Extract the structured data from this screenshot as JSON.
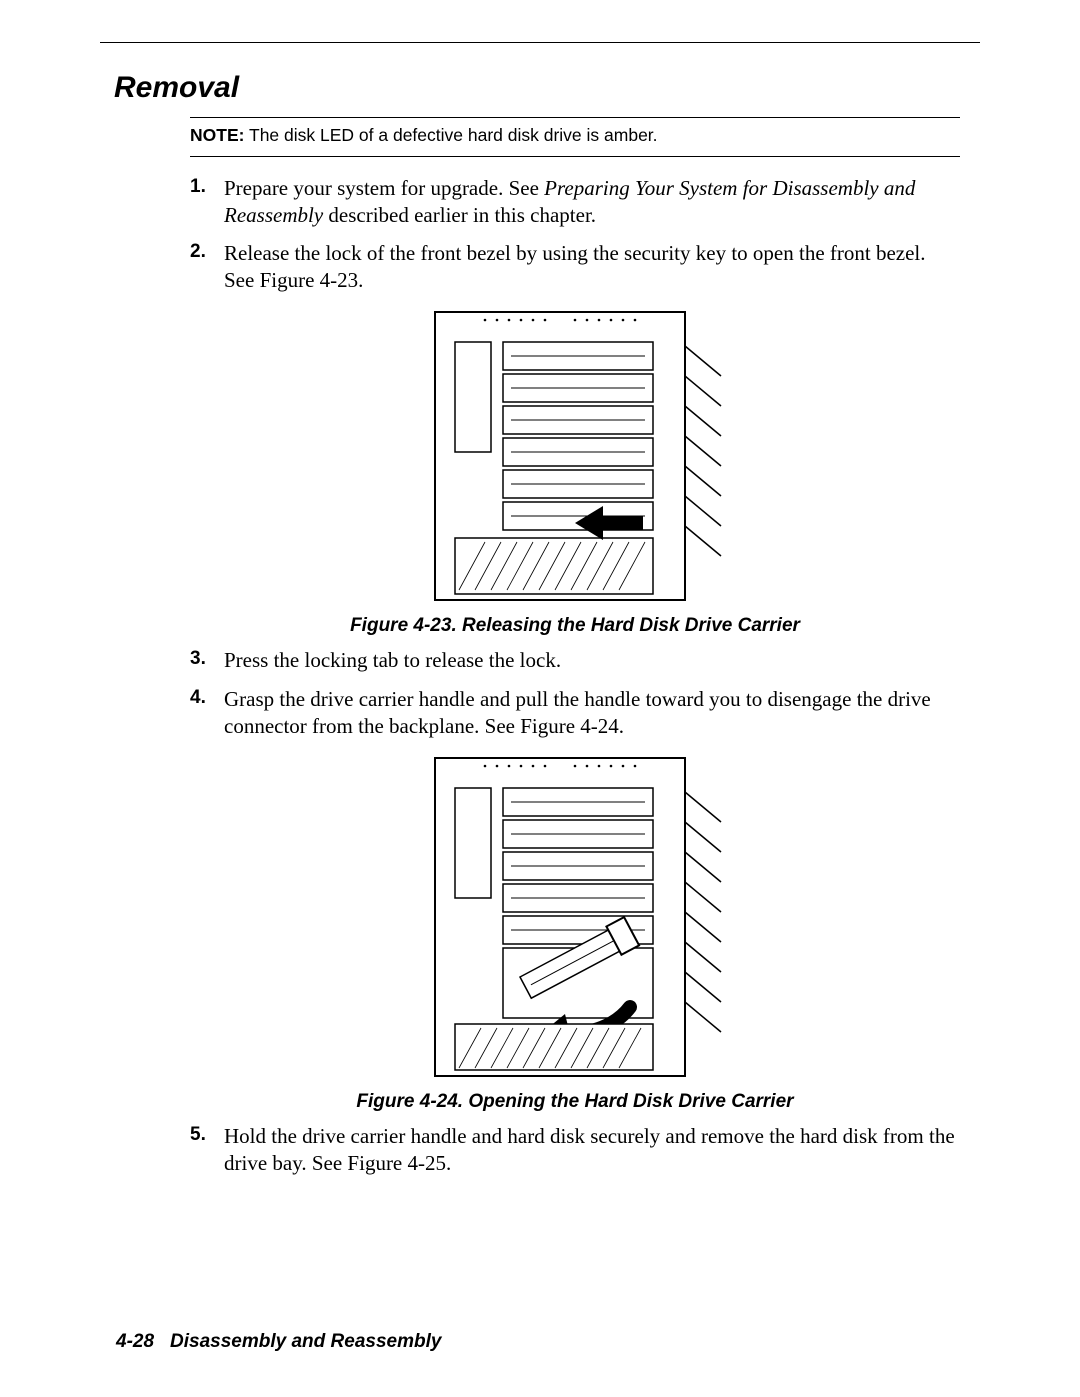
{
  "section_title": "Removal",
  "note": {
    "label": "NOTE:",
    "text": "The disk LED of a defective hard disk drive is amber."
  },
  "steps": {
    "s1": {
      "num": "1.",
      "text_pre": "Prepare your system for upgrade. See ",
      "ref": "Preparing Your System for Disassembly and Reassembly",
      "text_post": " described earlier in this chapter."
    },
    "s2": {
      "num": "2.",
      "text": "Release the lock of the front bezel by using the security key to open the front bezel. See Figure 4-23."
    },
    "s3": {
      "num": "3.",
      "text": "Press the locking tab to release the lock."
    },
    "s4": {
      "num": "4.",
      "text": "Grasp the drive carrier handle and pull the handle toward you to disengage the drive connector from the backplane. See Figure 4-24."
    },
    "s5": {
      "num": "5.",
      "text": "Hold the drive carrier handle and hard disk securely and remove the hard disk from the drive bay. See Figure 4-25."
    }
  },
  "captions": {
    "fig23": "Figure 4-23. Releasing the Hard Disk Drive Carrier",
    "fig24": "Figure 4-24. Opening the Hard Disk Drive Carrier"
  },
  "footer": {
    "page": "4-28",
    "title": "Disassembly and Reassembly"
  }
}
